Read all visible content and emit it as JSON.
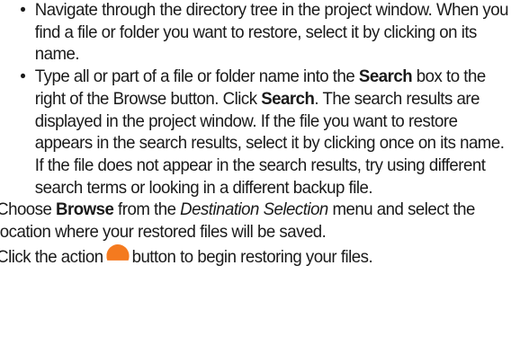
{
  "bullets": [
    {
      "text": "Navigate through the directory tree in the project window. When you find a file or folder you want to restore, select it by clicking on its name."
    },
    {
      "part1": "Type all or part of a file or folder name into the ",
      "bold1": "Search",
      "part2": " box to the right of the Browse button. Click ",
      "bold2": "Search",
      "part3": ". The search results are displayed in the project window. If the file you want to restore appears in the search results, select it by clicking once on its name. If the file does not appear in the search results, try using different search terms or looking in a different backup file."
    }
  ],
  "step_browse": {
    "part1": "Choose ",
    "bold": "Browse",
    "part2": " from the ",
    "italic": "Destination Selection",
    "part3": " menu and select the location where your restored files will be saved."
  },
  "step_action": {
    "part1": "Click the action",
    "part2": "button to begin restoring your files."
  },
  "icons": {
    "action": "orange-circle-button-icon"
  },
  "colors": {
    "text": "#1a1a1a",
    "action_button": "#f47a1f"
  }
}
